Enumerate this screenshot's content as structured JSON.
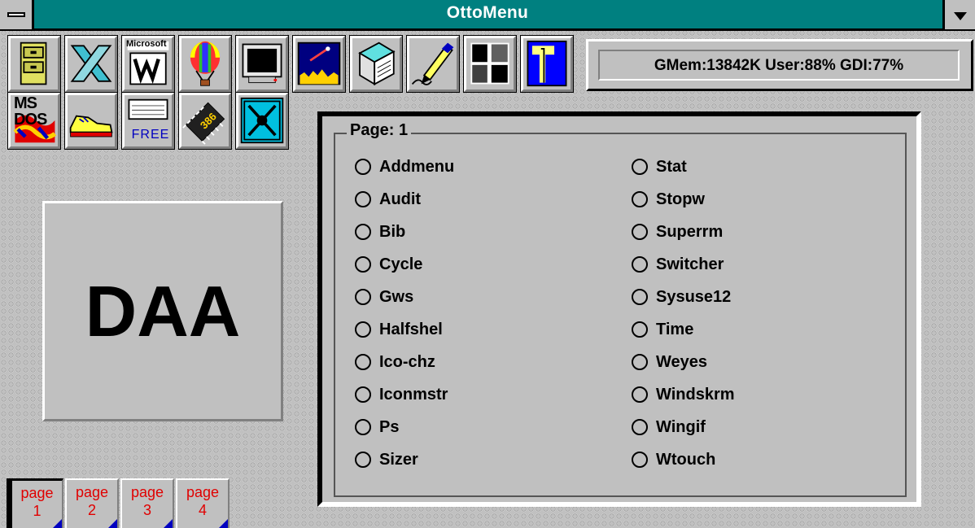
{
  "window": {
    "title": "OttoMenu"
  },
  "toolbar": {
    "row1_icons": [
      "file-cabinet-icon",
      "x-windows-icon",
      "microsoft-word-icon",
      "hot-air-balloon-icon",
      "monitor-icon",
      "starfield-icon",
      "notepad-icon",
      "pen-icon",
      "paint-icon",
      "taskbar-icon"
    ],
    "row2_icons": [
      "ms-dos-icon",
      "sneaker-icon",
      "free-memory-icon",
      "cpu-386-icon",
      "crosshair-icon"
    ],
    "free_label": "FREE",
    "cpu_label": "386",
    "msdos_label": "MS DOS",
    "microsoft_label": "Microsoft"
  },
  "status": {
    "text": "GMem:13842K  User:88%  GDI:77%"
  },
  "preview": {
    "label": "DAA"
  },
  "page_tabs": [
    {
      "word": "page",
      "num": "1",
      "active": true
    },
    {
      "word": "page",
      "num": "2",
      "active": false
    },
    {
      "word": "page",
      "num": "3",
      "active": false
    },
    {
      "word": "page",
      "num": "4",
      "active": false
    }
  ],
  "group": {
    "label": "Page: 1",
    "column1": [
      "Addmenu",
      "Audit",
      "Bib",
      "Cycle",
      "Gws",
      "Halfshel",
      "Ico-chz",
      "Iconmstr",
      "Ps",
      "Sizer"
    ],
    "column2": [
      "Stat",
      "Stopw",
      "Superrm",
      "Switcher",
      "Sysuse12",
      "Time",
      "Weyes",
      "Windskrm",
      "Wingif",
      "Wtouch"
    ]
  },
  "colors": {
    "titlebar": "#008080",
    "face": "#c0c0c0",
    "tab_text": "#e00000",
    "tab_corner": "#0000c0"
  }
}
